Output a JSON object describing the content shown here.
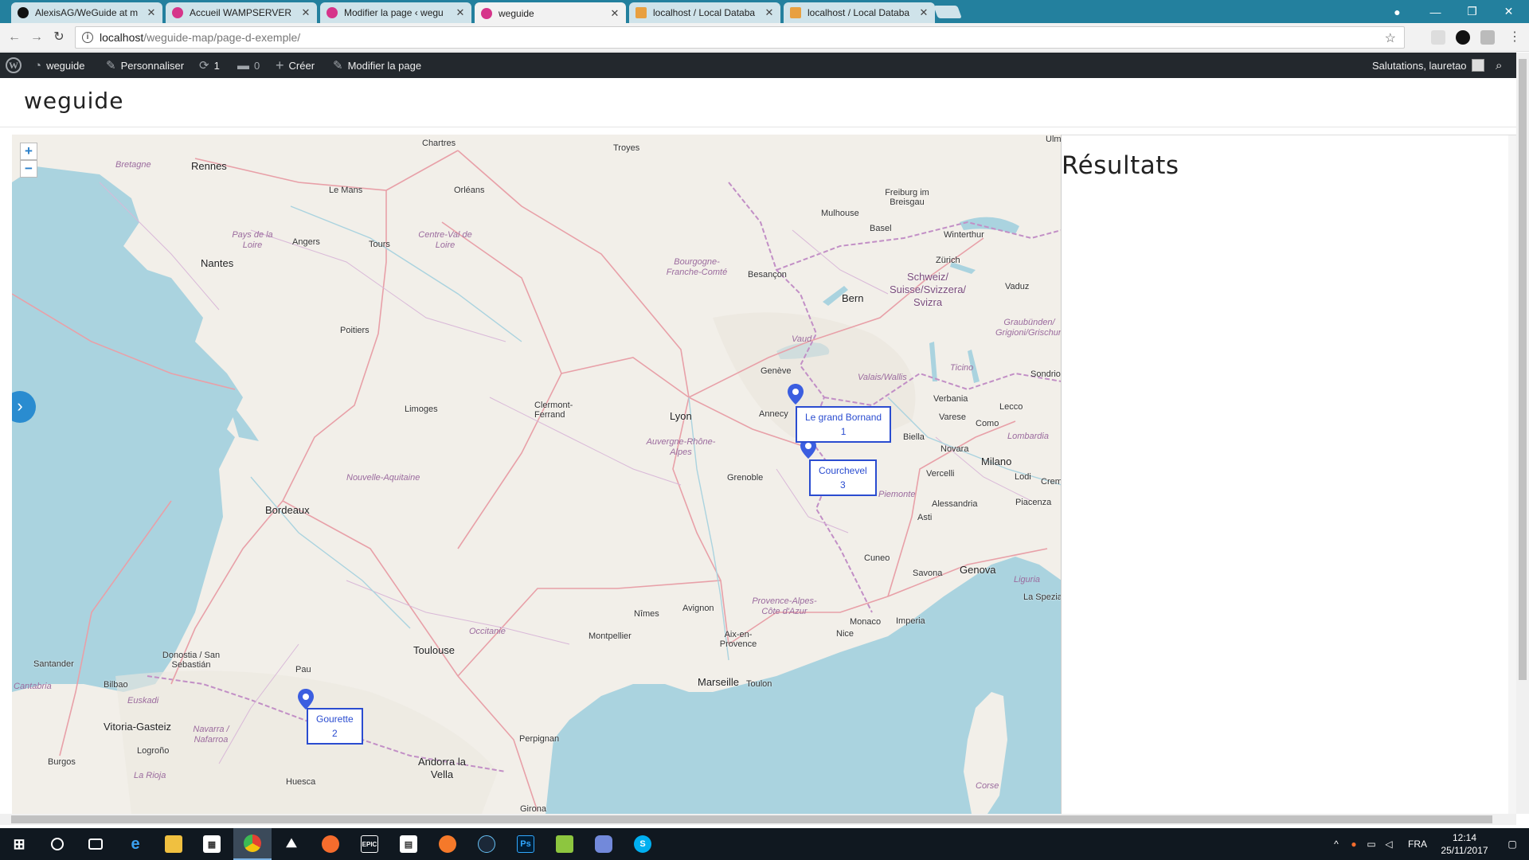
{
  "browser": {
    "tabs": [
      {
        "label": "AlexisAG/WeGuide at m",
        "favicon": "github-icon",
        "active": false
      },
      {
        "label": "Accueil WAMPSERVER",
        "favicon": "wordpress-icon",
        "active": false
      },
      {
        "label": "Modifier la page ‹ wegu",
        "favicon": "wordpress-icon",
        "active": false
      },
      {
        "label": "weguide",
        "favicon": "wordpress-icon",
        "active": true
      },
      {
        "label": "localhost / Local Databa",
        "favicon": "phpmyadmin-icon",
        "active": false
      },
      {
        "label": "localhost / Local Databa",
        "favicon": "phpmyadmin-icon",
        "active": false
      }
    ],
    "url_host": "localhost",
    "url_path": "/weguide-map/page-d-exemple/"
  },
  "adminbar": {
    "site_name": "weguide",
    "customize": "Personnaliser",
    "updates_count": "1",
    "comments_count": "0",
    "create": "Créer",
    "edit_page": "Modifier la page",
    "greeting": "Salutations, lauretao"
  },
  "site": {
    "title": "weguide"
  },
  "map": {
    "zoom_in": "+",
    "zoom_out": "−",
    "toggle": "›",
    "cities": [
      {
        "name": "Chartres"
      },
      {
        "name": "Troyes"
      },
      {
        "name": "Rennes"
      },
      {
        "name": "Le Mans"
      },
      {
        "name": "Orléans"
      },
      {
        "name": "Nantes"
      },
      {
        "name": "Angers"
      },
      {
        "name": "Tours"
      },
      {
        "name": "Poitiers"
      },
      {
        "name": "Limoges"
      },
      {
        "name": "Clermont-Ferrand"
      },
      {
        "name": "Lyon"
      },
      {
        "name": "Bordeaux"
      },
      {
        "name": "Toulouse"
      },
      {
        "name": "Pau"
      },
      {
        "name": "Montpellier"
      },
      {
        "name": "Nîmes"
      },
      {
        "name": "Avignon"
      },
      {
        "name": "Marseille"
      },
      {
        "name": "Toulon"
      },
      {
        "name": "Nice"
      },
      {
        "name": "Monaco"
      },
      {
        "name": "Genève"
      },
      {
        "name": "Annecy"
      },
      {
        "name": "Grenoble"
      },
      {
        "name": "Besançon"
      },
      {
        "name": "Mulhouse"
      },
      {
        "name": "Basel"
      },
      {
        "name": "Bern"
      },
      {
        "name": "Zürich"
      },
      {
        "name": "Winterthur"
      },
      {
        "name": "Freiburg im Breisgau"
      },
      {
        "name": "Vaduz"
      },
      {
        "name": "Milano"
      },
      {
        "name": "Genova"
      },
      {
        "name": "Cuneo"
      },
      {
        "name": "Savona"
      },
      {
        "name": "Asti"
      },
      {
        "name": "Alessandria"
      },
      {
        "name": "Biella"
      },
      {
        "name": "Novara"
      },
      {
        "name": "Vercelli"
      },
      {
        "name": "Varese"
      },
      {
        "name": "Como"
      },
      {
        "name": "Lecco"
      },
      {
        "name": "Verbania"
      },
      {
        "name": "Lodi"
      },
      {
        "name": "Piacenza"
      },
      {
        "name": "Imperia"
      },
      {
        "name": "La Spezia"
      },
      {
        "name": "Sondrio"
      },
      {
        "name": "Bilbao"
      },
      {
        "name": "Santander"
      },
      {
        "name": "Donostia / San Sebastián"
      },
      {
        "name": "Vitoria-Gasteiz"
      },
      {
        "name": "Burgos"
      },
      {
        "name": "Logroño"
      },
      {
        "name": "Huesca"
      },
      {
        "name": "Andorra la Vella"
      },
      {
        "name": "Perpignan"
      },
      {
        "name": "Girona"
      },
      {
        "name": "Aix-en-Provence"
      },
      {
        "name": "Ulm"
      },
      {
        "name": "Crem"
      }
    ],
    "regions": [
      {
        "name": "Bretagne"
      },
      {
        "name": "Pays de la Loire"
      },
      {
        "name": "Centre-Val de Loire"
      },
      {
        "name": "Bourgogne-Franche-Comté"
      },
      {
        "name": "Nouvelle-Aquitaine"
      },
      {
        "name": "Auvergne-Rhône-Alpes"
      },
      {
        "name": "Occitanie"
      },
      {
        "name": "Provence-Alpes-Côte d'Azur"
      },
      {
        "name": "Schweiz/ Suisse/Svizzera/ Svizra"
      },
      {
        "name": "Vaud"
      },
      {
        "name": "Valais/Wallis"
      },
      {
        "name": "Ticino"
      },
      {
        "name": "Graubünden/ Grigioni/Grischun"
      },
      {
        "name": "Lombardia"
      },
      {
        "name": "Liguria"
      },
      {
        "name": "Piemonte"
      },
      {
        "name": "Cantabria"
      },
      {
        "name": "Euskadi"
      },
      {
        "name": "Navarra / Nafarroa"
      },
      {
        "name": "La Rioja"
      },
      {
        "name": "Corse"
      }
    ],
    "markers": [
      {
        "name": "Le grand Bornand",
        "number": "1"
      },
      {
        "name": "Courchevel",
        "number": "3"
      },
      {
        "name": "Gourette",
        "number": "2"
      }
    ]
  },
  "results": {
    "title": "Résultats"
  },
  "taskbar": {
    "apps": [
      "windows-start",
      "search",
      "task-view",
      "edge",
      "file-explorer",
      "store",
      "chrome",
      "unity",
      "origin",
      "epic-games",
      "calculator",
      "blender",
      "steam",
      "photoshop",
      "notepad",
      "discord",
      "skype"
    ],
    "language": "FRA",
    "time": "12:14",
    "date": "25/11/2017"
  },
  "colors": {
    "accent": "#2a8cd0",
    "marker": "#3b5ee0",
    "popup_border": "#2a4cd0",
    "water": "#aad3df",
    "land": "#f2efe9",
    "adminbar": "#23282d",
    "tabstrip": "#23809e"
  }
}
